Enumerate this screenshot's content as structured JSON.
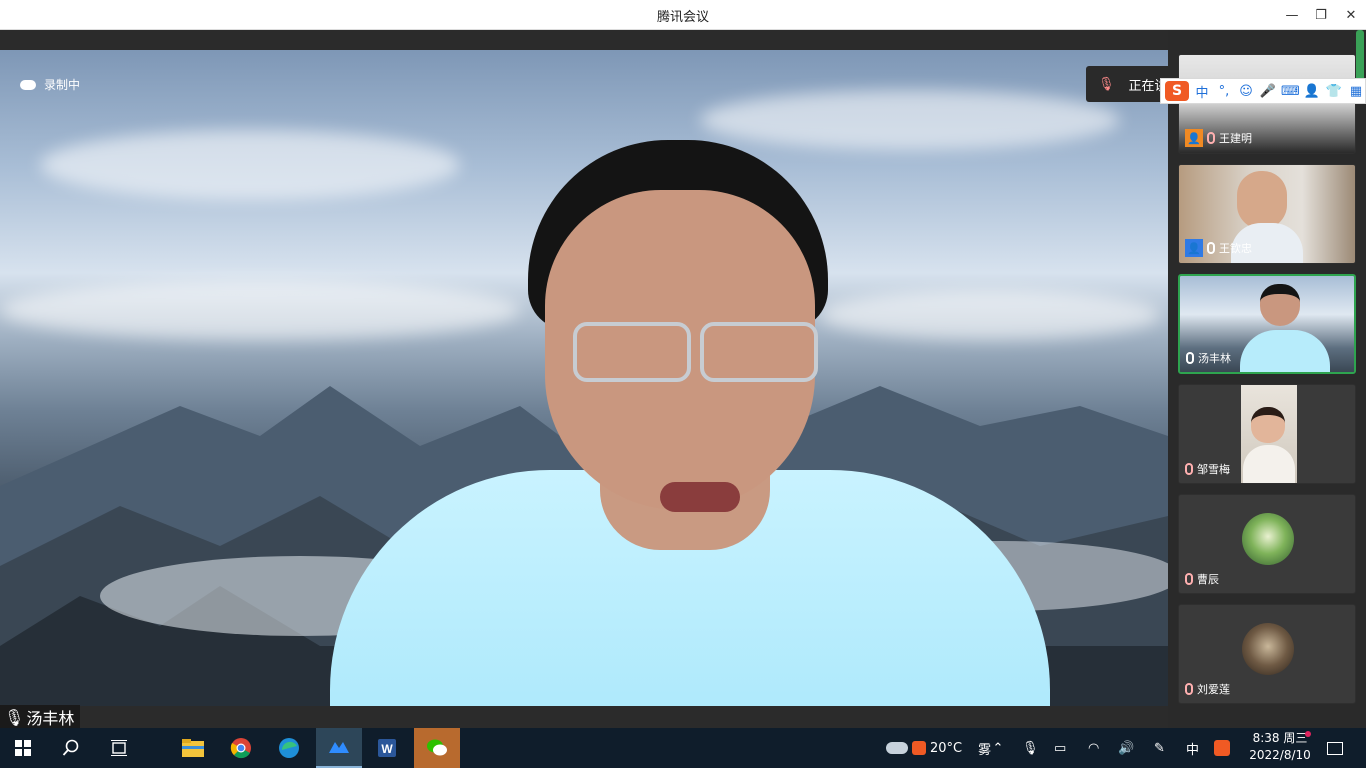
{
  "window": {
    "title": "腾讯会议"
  },
  "window_controls": {
    "minimize": "—",
    "maximize": "❐",
    "close": "✕"
  },
  "recording": {
    "label": "录制中"
  },
  "speaking_toast": {
    "text": "正在讲"
  },
  "main_speaker": {
    "name": "汤丰林"
  },
  "ime": {
    "logo": "S",
    "mode": "中",
    "punct": "°,",
    "icons": [
      "☺",
      "🎤",
      "⌨",
      "👤",
      "👕",
      "▦"
    ]
  },
  "participants": [
    {
      "name": "王建明",
      "mic": "muted",
      "badge": "host"
    },
    {
      "name": "王钦忠",
      "mic": "on",
      "badge": "cohost"
    },
    {
      "name": "汤丰林",
      "mic": "on",
      "active": true
    },
    {
      "name": "邹雪梅",
      "mic": "muted"
    },
    {
      "name": "曹辰",
      "mic": "muted"
    },
    {
      "name": "刘爱莲",
      "mic": "muted"
    }
  ],
  "taskbar": {
    "weather_temp": "20°C",
    "weather_desc": "雾",
    "ime_indicator": "中",
    "time": "8:38 周三",
    "date": "2022/8/10"
  },
  "colors": {
    "active_border": "#2ea44f",
    "accent_orange": "#f05a24",
    "taskbar": "#0f1d2b"
  }
}
